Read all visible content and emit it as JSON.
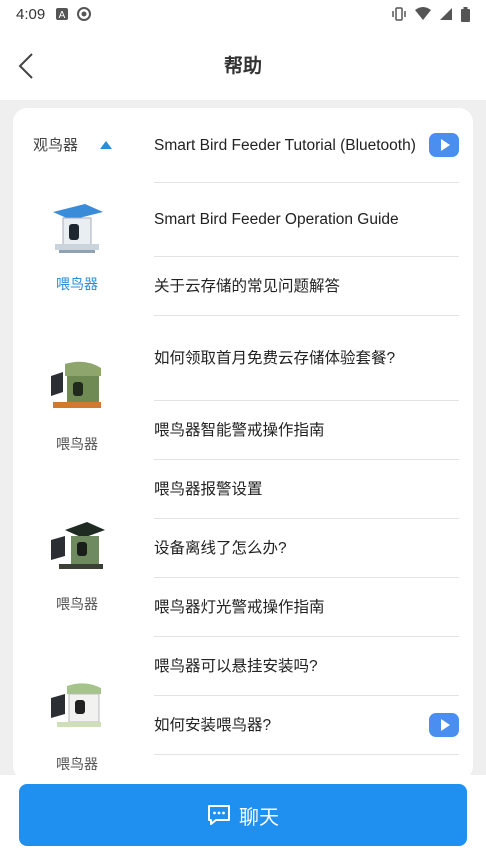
{
  "status_bar": {
    "time": "4:09",
    "left_icons": [
      "a-icon",
      "circle-icon"
    ],
    "right_icons": [
      "vibrate-icon",
      "wifi-icon",
      "signal-icon",
      "battery-icon"
    ]
  },
  "header": {
    "title": "帮助",
    "back_icon": "chevron-left-icon"
  },
  "categories": [
    {
      "label": "观鸟器",
      "active": false
    },
    {
      "label": "喂鸟器",
      "active": true
    },
    {
      "label": "喂鸟器",
      "active": false
    },
    {
      "label": "喂鸟器",
      "active": false
    },
    {
      "label": "喂鸟器",
      "active": false
    }
  ],
  "help_items": [
    {
      "title": "Smart Bird Feeder Tutorial (Bluetooth)",
      "has_video": true
    },
    {
      "title": "Smart Bird Feeder Operation Guide",
      "has_video": false
    },
    {
      "title": "关于云存储的常见问题解答",
      "has_video": false
    },
    {
      "title": "如何领取首月免费云存储体验套餐?",
      "has_video": false
    },
    {
      "title": "喂鸟器智能警戒操作指南",
      "has_video": false
    },
    {
      "title": "喂鸟器报警设置",
      "has_video": false
    },
    {
      "title": "设备离线了怎么办?",
      "has_video": false
    },
    {
      "title": "喂鸟器灯光警戒操作指南",
      "has_video": false
    },
    {
      "title": "喂鸟器可以悬挂安装吗?",
      "has_video": false
    },
    {
      "title": "如何安装喂鸟器?",
      "has_video": true
    }
  ],
  "chat_button": {
    "label": "聊天",
    "icon": "chat-bubble-icon"
  },
  "colors": {
    "accent": "#1f8ff0",
    "active_category": "#2a8ed8",
    "play_button": "#4a8ff0"
  }
}
